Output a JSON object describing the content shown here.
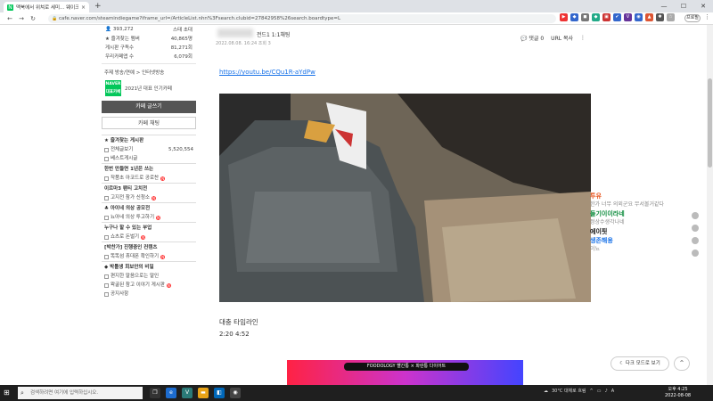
{
  "browser": {
    "tab_title": "맥북에서 위쳐로 세미... 웨이크 ",
    "tab_close": "×",
    "new_tab": "+",
    "url": "cafe.naver.com/steamindiegame?iframe_url=/ArticleList.nhn%3Fsearch.clubid=27842958%26search.boardtype=L",
    "profile_label": "프로필",
    "win_min": "—",
    "win_max": "☐",
    "win_close": "✕"
  },
  "sidebar": {
    "stats": [
      {
        "label": "",
        "value": "393,272",
        "extra": "스태 초대"
      },
      {
        "label": "★ 즐겨찾는 멤버",
        "value": "40,865명"
      },
      {
        "label": "게시판 구독수",
        "value": "81,271회"
      },
      {
        "label": "우리카페앱 수",
        "value": "6,079회"
      }
    ],
    "topic": "주제  방송/연예 > 인터넷방송",
    "badge_top": "NAVER",
    "badge_bottom": "대표카페",
    "badge_text": "2021년 대표 인기카페",
    "write_button": "카페 글쓰기",
    "chat_button": "카페 채팅",
    "favorites_title": "★ 즐겨찾는 게시판",
    "items": [
      {
        "label": "전체글보기",
        "count": "5,520,554",
        "new": false
      },
      {
        "label": "베스트게시글",
        "count": "",
        "new": false
      },
      {
        "label": "한번 만들면 1년은 쓰는",
        "count": "",
        "new": false,
        "title": true
      },
      {
        "label": "작품초 아코드로 공로찬",
        "count": "",
        "new": true
      },
      {
        "label": "이르마3 팬티 고치전",
        "count": "",
        "new": false,
        "title": true
      },
      {
        "label": "고지전 참가 신청소",
        "count": "",
        "new": true
      },
      {
        "label": "♣ 아이네 의상 공모전",
        "count": "",
        "new": false,
        "title": true
      },
      {
        "label": "뇨아네 의상 투고하기",
        "count": "",
        "new": true
      },
      {
        "label": "누구나 할 수 있는 부업",
        "count": "",
        "new": false,
        "title": true
      },
      {
        "label": "쇼츠로 돈벌기",
        "count": "",
        "new": true
      },
      {
        "label": "[박찬가] 진행중인 컨텐츠",
        "count": "",
        "new": false,
        "title": true
      },
      {
        "label": "똑똑섬 휴대폰 확인하기",
        "count": "",
        "new": true
      },
      {
        "label": "◆ 박틀생 회보안의 비밀",
        "count": "",
        "new": false,
        "title": true
      },
      {
        "label": "편지한 말음으로는 말인",
        "count": "",
        "new": false
      },
      {
        "label": "왁굴된 참고 이야기 게시판",
        "count": "",
        "new": true
      },
      {
        "label": "공지사항",
        "count": "",
        "new": false
      }
    ],
    "new_mark": "N"
  },
  "post": {
    "author": "전드1  1:1채팅",
    "date": "2022.08.08. 16:24  조회 3",
    "comments": "댓글 0",
    "url_copy": "URL 복사",
    "more": "⋮",
    "link": "https://youtu.be/CQu1R-aYdPw",
    "body1": "대충 타임라인",
    "body2": "2:20 4:52",
    "ad_pill": "FOODOLOGY 빨간통 × 파란통 다이어트"
  },
  "chat": [
    {
      "name": "투유",
      "msg": "한가 너무 의외군요 무서볼거같다",
      "color": "#e8541c"
    },
    {
      "name": "들기이이라네",
      "msg": "정상수생각나네",
      "color": "#0a8a3a"
    },
    {
      "name": "에이핏",
      "msg": "",
      "color": "#111111"
    },
    {
      "name": "생존해용",
      "msg": "이뇨",
      "color": "#1a73e8"
    }
  ],
  "float": {
    "darkmode": "다크 모드로 보기",
    "totop": "⌃"
  },
  "taskbar": {
    "start": "⊞",
    "search": "검색하려면 여기에 입력하십시오.",
    "weather": "30°C 대체로 흐림",
    "lang": "A",
    "time": "오후 4:25",
    "date": "2022-08-08"
  },
  "colors": {
    "naver_green": "#03c75a",
    "link_blue": "#1a73e8"
  }
}
